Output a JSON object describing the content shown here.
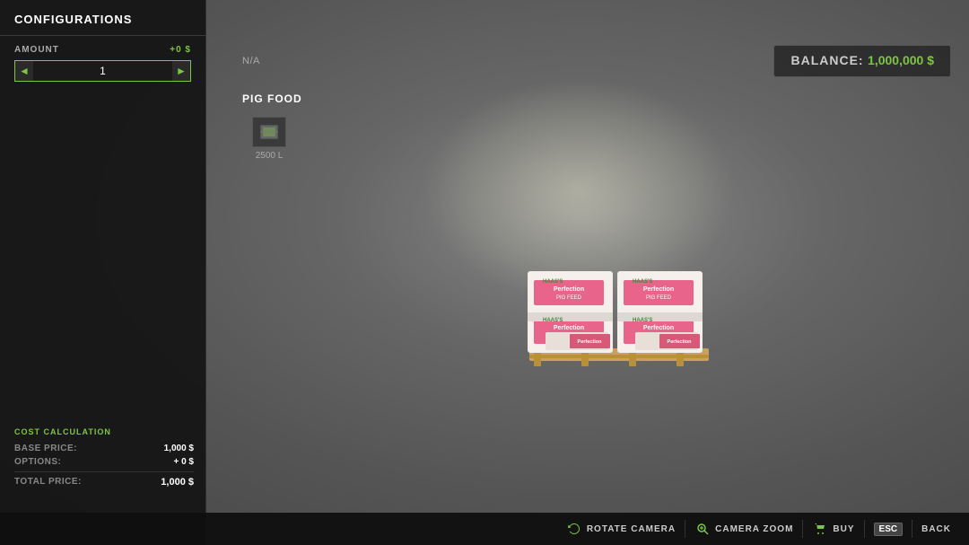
{
  "sidebar": {
    "title": "CONFIGURATIONS",
    "amount": {
      "label": "AMOUNT",
      "delta": "+0 $",
      "value": "1",
      "min_btn": "◄",
      "max_btn": "►"
    }
  },
  "product": {
    "na_label": "N/A",
    "name": "PIG FOOD",
    "volume": "2500 L"
  },
  "balance": {
    "label": "BALANCE:",
    "amount": "1,000,000 $"
  },
  "cost_calculation": {
    "title": "COST CALCULATION",
    "base_price_label": "BASE PRICE:",
    "base_price_value": "1,000 $",
    "options_label": "OPTIONS:",
    "options_value": "+ 0 $",
    "total_label": "TOTAL PRICE:",
    "total_value": "1,000 $"
  },
  "toolbar": {
    "rotate_camera_label": "ROTATE CAMERA",
    "camera_zoom_label": "CAMERA ZOOM",
    "buy_label": "BUY",
    "esc_label": "ESC",
    "back_label": "BACK"
  },
  "colors": {
    "accent_green": "#7dc642",
    "dark_bg": "#141414",
    "toolbar_bg": "#0f0f0f"
  }
}
